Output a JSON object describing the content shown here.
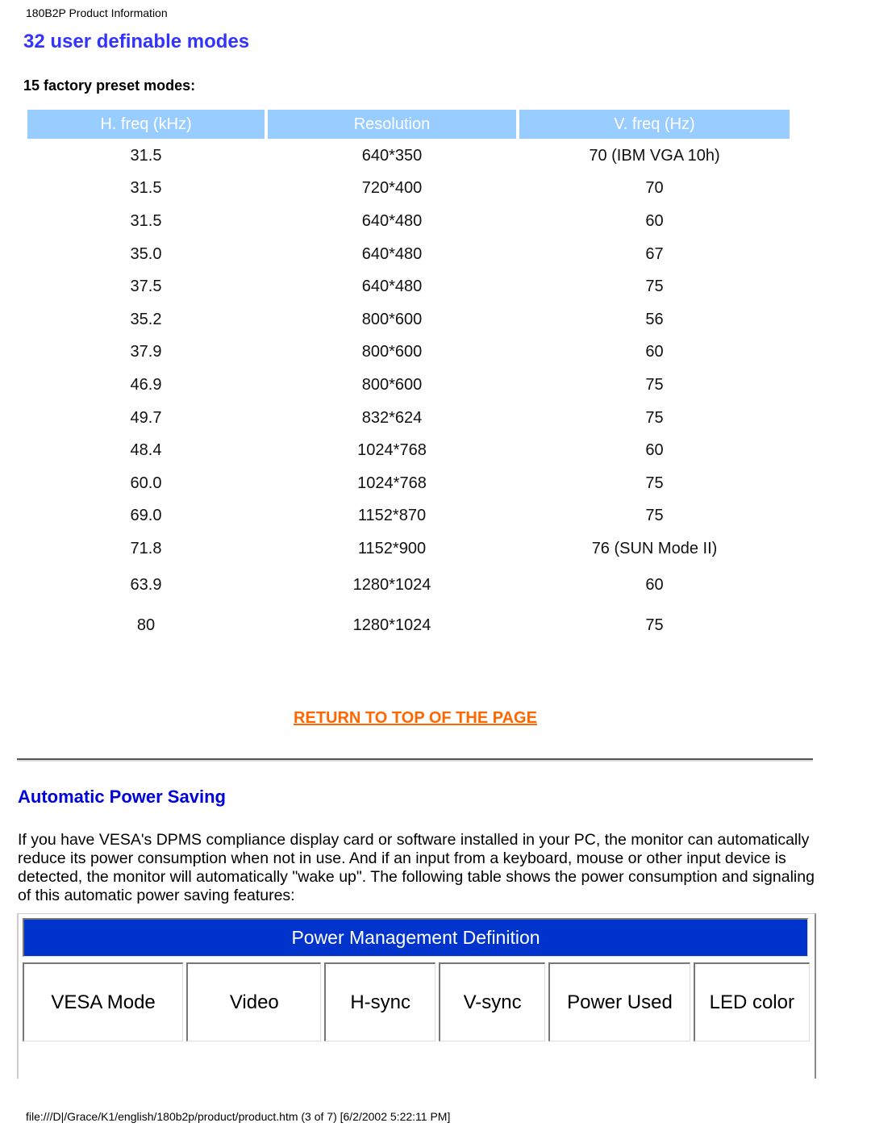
{
  "header": {
    "title": "180B2P Product Information"
  },
  "user_modes": {
    "title": "32 user definable modes",
    "subtitle": "15 factory preset modes:",
    "columns": [
      "H. freq (kHz)",
      "Resolution",
      "V. freq (Hz)"
    ],
    "rows": [
      [
        "31.5",
        "640*350",
        "70 (IBM VGA 10h)"
      ],
      [
        "31.5",
        "720*400",
        "70"
      ],
      [
        "31.5",
        "640*480",
        "60"
      ],
      [
        "35.0",
        "640*480",
        "67"
      ],
      [
        "37.5",
        "640*480",
        "75"
      ],
      [
        "35.2",
        "800*600",
        "56"
      ],
      [
        "37.9",
        "800*600",
        "60"
      ],
      [
        "46.9",
        "800*600",
        "75"
      ],
      [
        "49.7",
        "832*624",
        "75"
      ],
      [
        "48.4",
        "1024*768",
        "60"
      ],
      [
        "60.0",
        "1024*768",
        "75"
      ],
      [
        "69.0",
        "1152*870",
        "75"
      ],
      [
        "71.8",
        "1152*900",
        "76 (SUN Mode II)"
      ],
      [
        "63.9",
        "1280*1024",
        "60"
      ],
      [
        "80",
        "1280*1024",
        "75"
      ]
    ],
    "header_color": "#99ccff"
  },
  "return_link": {
    "label": "RETURN TO TOP OF THE PAGE",
    "color": "#ff6600"
  },
  "power_saving": {
    "title": "Automatic Power Saving",
    "intro": "If you have VESA's DPMS compliance display card or software installed in your PC, the monitor can automatically reduce its power consumption when not in use. And if an input from a keyboard, mouse or other input device is detected, the monitor will automatically \"wake up\". The following table shows the power consumption and signaling of this automatic power saving features:",
    "table": {
      "title": "Power Management Definition",
      "title_bg": "#0033cc",
      "columns": [
        "VESA Mode",
        "Video",
        "H-sync",
        "V-sync",
        "Power Used",
        "LED color"
      ]
    }
  },
  "footer": {
    "text": "file:///D|/Grace/K1/english/180b2p/product/product.htm (3 of 7) [6/2/2002 5:22:11 PM]"
  }
}
